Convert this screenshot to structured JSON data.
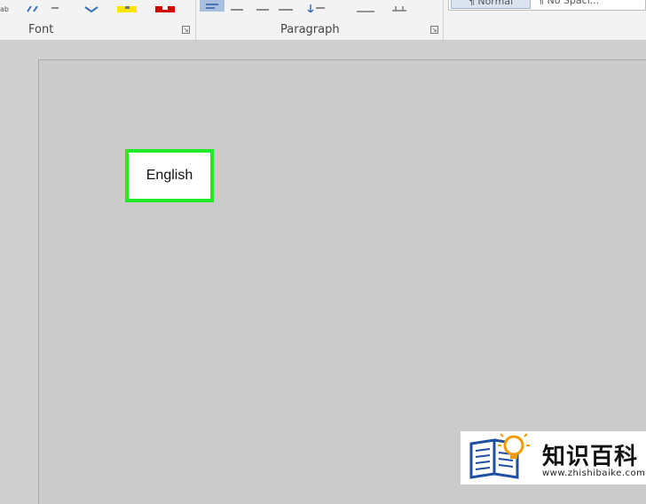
{
  "ribbon": {
    "font_group_label": "Font",
    "paragraph_group_label": "Paragraph",
    "styles": {
      "normal": "¶ Normal",
      "no_spacing": "¶ No Spaci..."
    },
    "icons": [
      "clear-formatting-icon",
      "text-effects-icon",
      "highlight-icon",
      "font-color-icon",
      "align-left-icon",
      "center-icon",
      "align-right-icon",
      "justify-icon",
      "line-spacing-icon",
      "shading-icon",
      "borders-icon"
    ],
    "colors": {
      "highlight": "#ffe600",
      "font_color": "#d10000",
      "active": "#a9bfe0"
    }
  },
  "document": {
    "language_option": "English",
    "highlight_color": "#22ea2a"
  },
  "watermark": {
    "title": "知识百科",
    "url": "www.zhishibaike.com"
  }
}
